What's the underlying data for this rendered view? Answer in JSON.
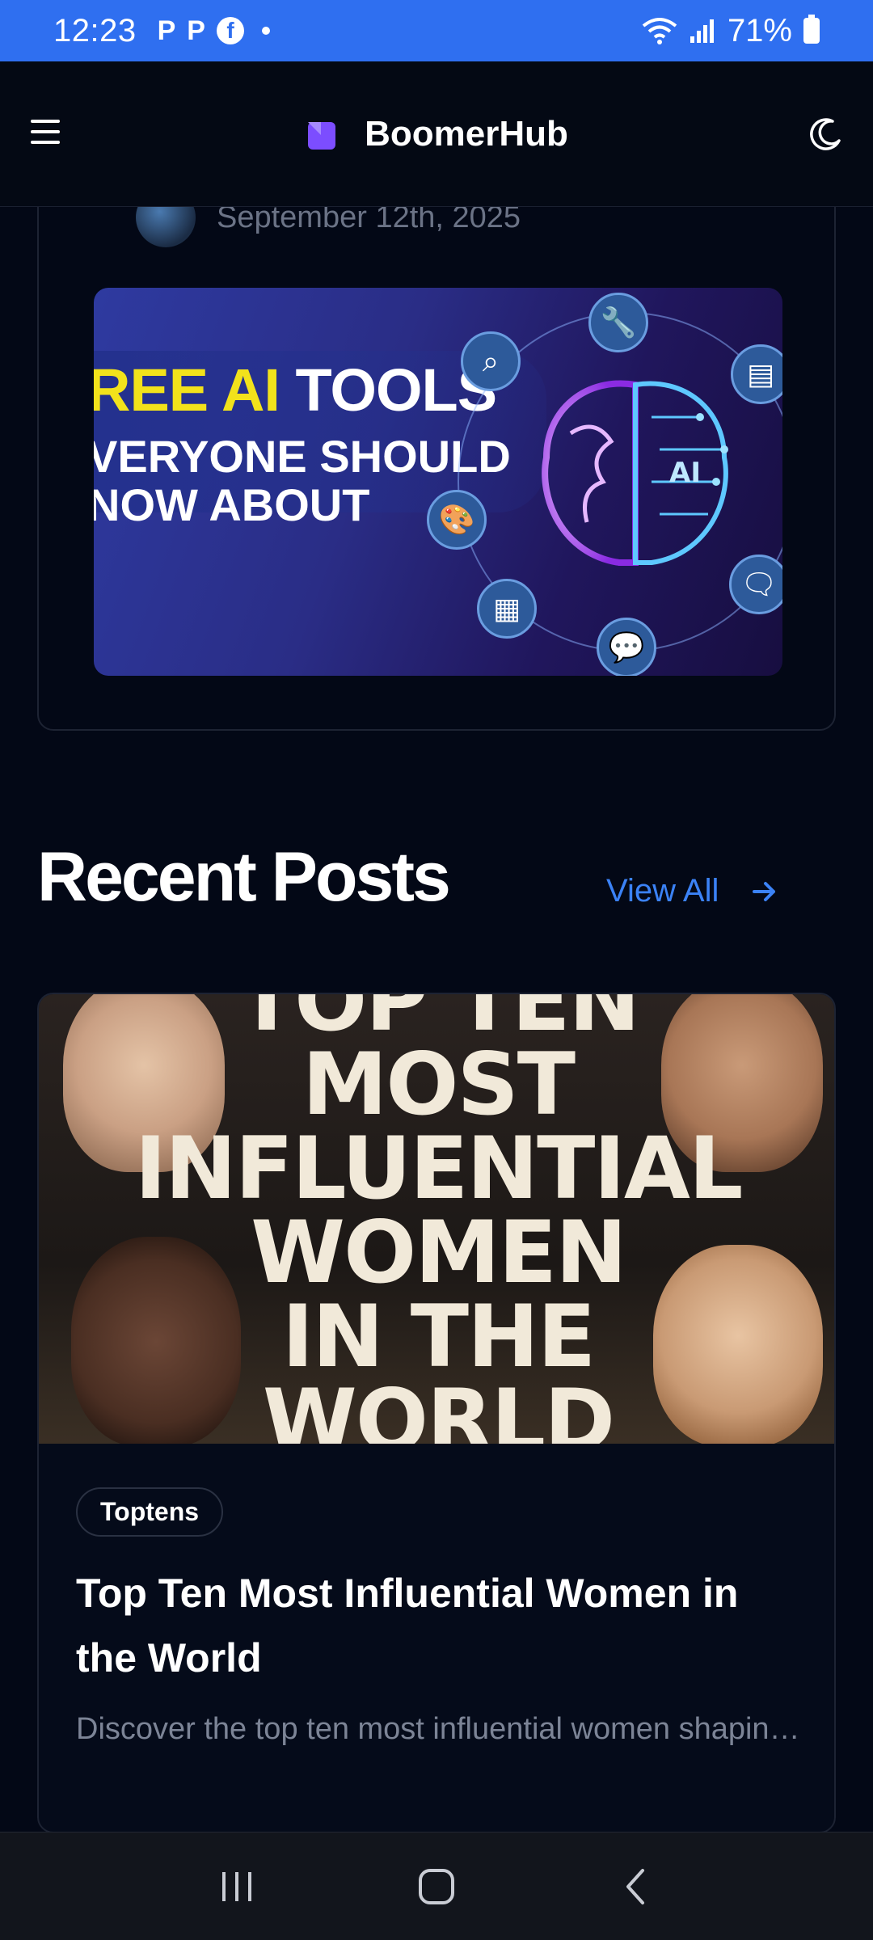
{
  "status_bar": {
    "time": "12:23",
    "app_icons": [
      "P",
      "P",
      "f"
    ],
    "battery": "71%"
  },
  "header": {
    "brand": "BoomerHub",
    "menu_icon": "hamburger-icon",
    "theme_icon": "moon-icon"
  },
  "featured": {
    "date": "September 12th, 2025",
    "image": {
      "line1_highlight": "REE AI",
      "line1_rest": " TOOLS",
      "line2": "VERYONE SHOULD",
      "line3": "NOW ABOUT",
      "brain_label": "AI"
    }
  },
  "recent": {
    "title": "Recent Posts",
    "view_all": "View All"
  },
  "post": {
    "poster_lines": [
      "TOP TEN",
      "MOST",
      "INFLUENTIAL",
      "WOMEN",
      "IN THE",
      "WORLD"
    ],
    "category": "Toptens",
    "title": "Top Ten Most Influential Women in the World",
    "excerpt": "Discover the top ten most influential women shaping politics, business, culture, and activis..."
  },
  "colors": {
    "status_bar": "#2f6ff0",
    "background": "#030816",
    "accent": "#3b82f6",
    "logo": "#7c4dff"
  }
}
